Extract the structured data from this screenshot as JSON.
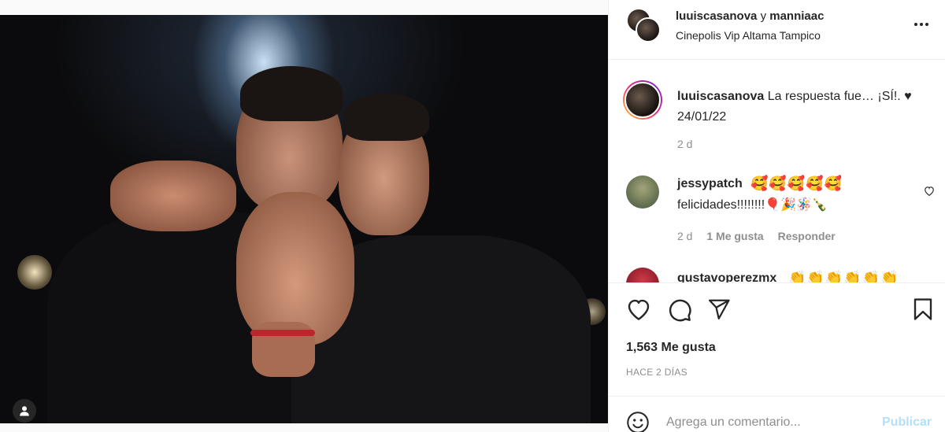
{
  "post": {
    "header": {
      "user1": "luuiscasanova",
      "conj": "y",
      "user2": "manniaac",
      "location": "Cinepolis Vip Altama Tampico"
    },
    "caption": {
      "username": "luuiscasanova",
      "text": "La respuesta fue… ¡SÍ!. ♥ 24/01/22",
      "time": "2 d"
    },
    "comments": [
      {
        "username": "jessypatch",
        "emojis": "🥰🥰🥰🥰🥰",
        "text": "felicidades!!!!!!!!🎈🎉🪅🍾",
        "time": "2 d",
        "likes": "1 Me gusta",
        "reply": "Responder"
      },
      {
        "username": "gustavoperezmx",
        "emojis": "👏👏👏👏👏👏"
      }
    ],
    "likes_count": "1,563 Me gusta",
    "time_ago": "HACE 2 DÍAS",
    "add_comment": {
      "placeholder": "Agrega un comentario...",
      "publish": "Publicar"
    }
  },
  "icons": {
    "more": "more-horizontal-icon",
    "like": "heart-icon",
    "comment": "comment-bubble-icon",
    "share": "paper-plane-icon",
    "save": "bookmark-icon",
    "emoji": "smiley-icon",
    "tag": "user-tag-icon"
  },
  "colors": {
    "text": "#262626",
    "muted": "#8e8e8e",
    "publish_disabled": "#b2dffc",
    "border": "#efefef"
  }
}
